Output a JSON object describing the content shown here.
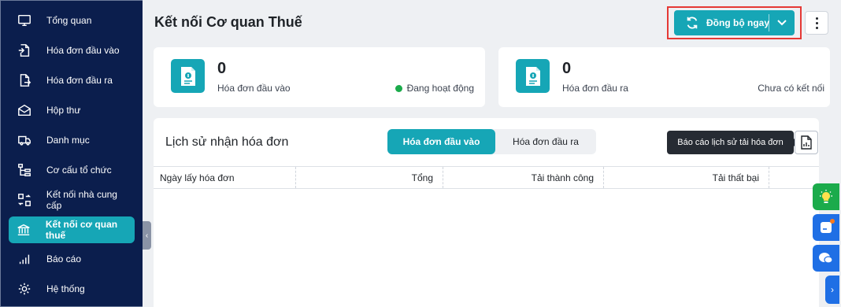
{
  "sidebar": {
    "items": [
      {
        "label": "Tổng quan",
        "icon": "monitor-icon"
      },
      {
        "label": "Hóa đơn đầu vào",
        "icon": "file-import-icon"
      },
      {
        "label": "Hóa đơn đầu ra",
        "icon": "file-export-icon"
      },
      {
        "label": "Hộp thư",
        "icon": "mail-icon"
      },
      {
        "label": "Danh mục",
        "icon": "truck-icon"
      },
      {
        "label": "Cơ cấu tổ chức",
        "icon": "org-tree-icon"
      },
      {
        "label": "Kết nối nhà cung cấp",
        "icon": "connect-icon"
      },
      {
        "label": "Kết nối cơ quan thuế",
        "icon": "bank-icon",
        "active": true
      },
      {
        "label": "Báo cáo",
        "icon": "bar-chart-icon"
      },
      {
        "label": "Hệ thống",
        "icon": "gear-icon"
      }
    ]
  },
  "header": {
    "title": "Kết nối Cơ quan Thuế",
    "sync_label": "Đồng bộ ngay"
  },
  "stats": {
    "input": {
      "count": "0",
      "label": "Hóa đơn đầu vào",
      "status": "Đang hoạt động"
    },
    "output": {
      "count": "0",
      "label": "Hóa đơn đầu ra",
      "status": "Chưa có kết nối"
    }
  },
  "history": {
    "title": "Lịch sử nhận hóa đơn",
    "tabs": [
      "Hóa đơn đầu vào",
      "Hóa đơn đầu ra"
    ],
    "tooltip": "Báo cáo lịch sử tải hóa đơn",
    "columns": [
      "Ngày lấy hóa đơn",
      "Tổng",
      "Tải thành công",
      "Tải thất bại",
      ""
    ]
  },
  "colors": {
    "accent": "#16a6b6",
    "sidebar": "#0b1e4d",
    "active_status": "#1bab4b",
    "highlight": "#e53935"
  }
}
